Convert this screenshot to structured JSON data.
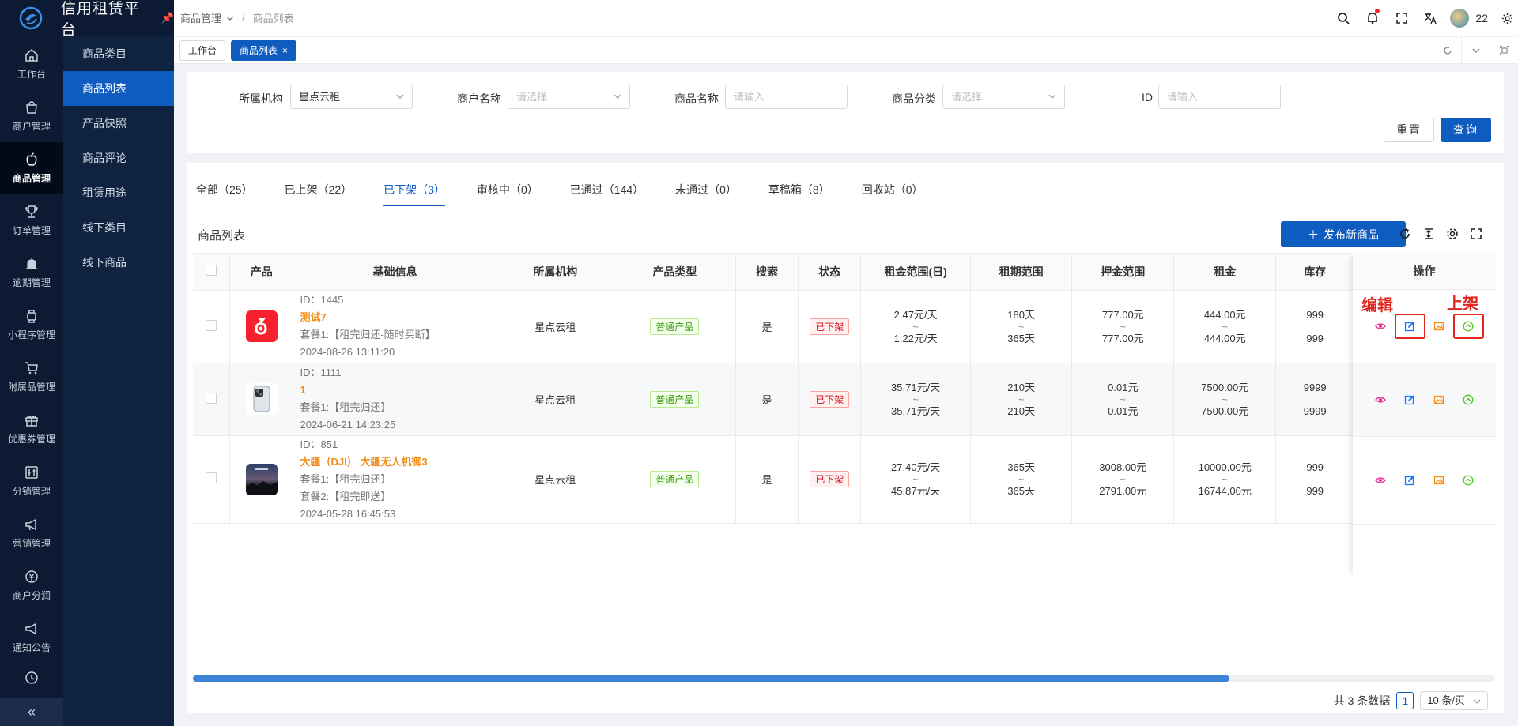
{
  "app": {
    "title": "信用租赁平台"
  },
  "rail": [
    {
      "label": "工作台",
      "icon": "home-icon"
    },
    {
      "label": "商户管理",
      "icon": "shop-icon"
    },
    {
      "label": "商品管理",
      "icon": "apple-icon",
      "active": true
    },
    {
      "label": "订单管理",
      "icon": "trophy-icon"
    },
    {
      "label": "逾期管理",
      "icon": "alarm-icon"
    },
    {
      "label": "小程序管理",
      "icon": "watch-icon"
    },
    {
      "label": "附属品管理",
      "icon": "cart-icon"
    },
    {
      "label": "优惠券管理",
      "icon": "gift-icon"
    },
    {
      "label": "分销管理",
      "icon": "sliders-icon"
    },
    {
      "label": "营销管理",
      "icon": "megaphone-icon"
    },
    {
      "label": "商户分润",
      "icon": "yen-icon"
    },
    {
      "label": "通知公告",
      "icon": "notice-icon"
    }
  ],
  "submenu": [
    {
      "label": "商品类目"
    },
    {
      "label": "商品列表",
      "active": true
    },
    {
      "label": "产品快照"
    },
    {
      "label": "商品评论"
    },
    {
      "label": "租赁用途"
    },
    {
      "label": "线下类目"
    },
    {
      "label": "线下商品"
    }
  ],
  "breadcrumb": {
    "parent": "商品管理",
    "current": "商品列表"
  },
  "header": {
    "username": "22"
  },
  "page_tabs": [
    {
      "label": "工作台"
    },
    {
      "label": "商品列表",
      "active": true
    }
  ],
  "filters": {
    "org": {
      "label": "所属机构",
      "value": "星点云租"
    },
    "merchant": {
      "label": "商户名称",
      "placeholder": "请选择"
    },
    "product_name": {
      "label": "商品名称",
      "placeholder": "请输入"
    },
    "category": {
      "label": "商品分类",
      "placeholder": "请选择"
    },
    "id": {
      "label": "ID",
      "placeholder": "请输入"
    },
    "reset_label": "重置",
    "query_label": "查询"
  },
  "status_tabs": [
    {
      "label": "全部（25）"
    },
    {
      "label": "已上架（22）"
    },
    {
      "label": "已下架（3）",
      "active": true
    },
    {
      "label": "审核中（0）"
    },
    {
      "label": "已通过（144）"
    },
    {
      "label": "未通过（0）"
    },
    {
      "label": "草稿箱（8）"
    },
    {
      "label": "回收站（0）"
    }
  ],
  "list": {
    "title": "商品列表",
    "publish_label": "发布新商品"
  },
  "columns": [
    "产品",
    "基础信息",
    "所属机构",
    "产品类型",
    "搜索",
    "状态",
    "租金范围(日)",
    "租期范围",
    "押金范围",
    "租金",
    "库存",
    "操作"
  ],
  "rows": [
    {
      "id_text": "ID：1445",
      "name": "测试7",
      "plans": [
        "套餐1:【租完归还-随时买断】"
      ],
      "time": "2024-08-26 13:11:20",
      "org": "星点云租",
      "type": "普通产品",
      "search": "是",
      "status": "已下架",
      "rent_day": [
        "2.47元/天",
        "~",
        "1.22元/天"
      ],
      "term": [
        "180天",
        "~",
        "365天"
      ],
      "deposit": [
        "777.00元",
        "~",
        "777.00元"
      ],
      "rent": [
        "444.00元",
        "~",
        "444.00元"
      ],
      "stock": [
        "999",
        "999"
      ],
      "img": "app-logo-red"
    },
    {
      "id_text": "ID：1111",
      "name": "1",
      "plans": [
        "套餐1:【租完归还】"
      ],
      "time": "2024-06-21 14:23:25",
      "org": "星点云租",
      "type": "普通产品",
      "search": "是",
      "status": "已下架",
      "rent_day": [
        "35.71元/天",
        "~",
        "35.71元/天"
      ],
      "term": [
        "210天",
        "~",
        "210天"
      ],
      "deposit": [
        "0.01元",
        "~",
        "0.01元"
      ],
      "rent": [
        "7500.00元",
        "~",
        "7500.00元"
      ],
      "stock": [
        "9999",
        "9999"
      ],
      "img": "phone"
    },
    {
      "id_text": "ID：851",
      "name": "大疆（DJI） 大疆无人机御3",
      "plans": [
        "套餐1:【租完归还】",
        "套餐2:【租完即送】"
      ],
      "time": "2024-05-28 16:45:53",
      "org": "星点云租",
      "type": "普通产品",
      "search": "是",
      "status": "已下架",
      "rent_day": [
        "27.40元/天",
        "~",
        "45.87元/天"
      ],
      "term": [
        "365天",
        "~",
        "365天"
      ],
      "deposit": [
        "3008.00元",
        "~",
        "2791.00元"
      ],
      "rent": [
        "10000.00元",
        "~",
        "16744.00元"
      ],
      "stock": [
        "999",
        "999"
      ],
      "img": "drone-box"
    }
  ],
  "annotations": {
    "edit": "编辑",
    "onshelf": "上架"
  },
  "pagination": {
    "total": "共 3 条数据",
    "page": "1",
    "size": "10 条/页"
  },
  "colors": {
    "primary": "#0f5cc0",
    "sidebar": "#0c1b33",
    "highlight": "#e0261f",
    "orange": "#f08c1a"
  }
}
